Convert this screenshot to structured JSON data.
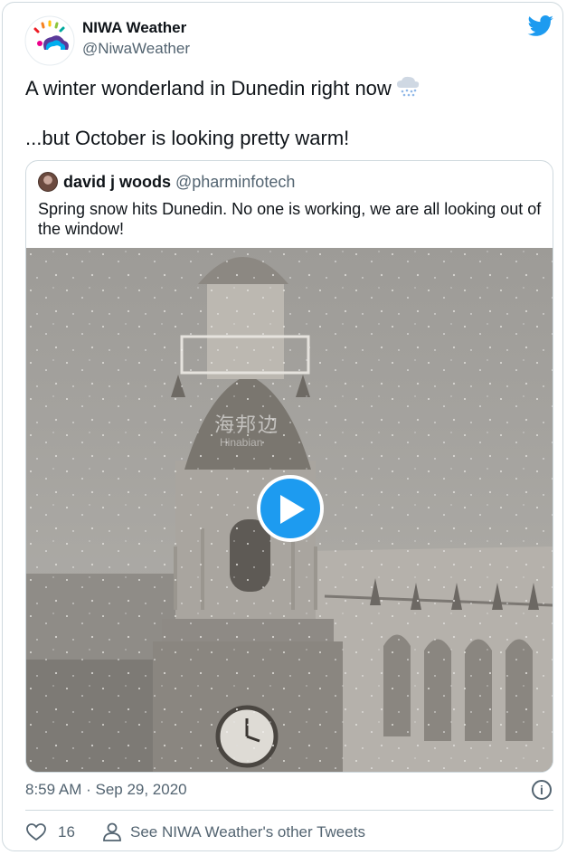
{
  "tweet": {
    "author_name": "NIWA Weather",
    "author_handle": "@NiwaWeather",
    "text_line1": "A winter wonderland in Dunedin right now",
    "text_line1_emoji": "cloud-with-snow-icon",
    "text_line2": "...but October is looking pretty warm!",
    "timestamp": "8:59 AM · Sep 29, 2020",
    "likes": "16",
    "see_other": "See NIWA Weather's other Tweets"
  },
  "quoted": {
    "author_name": "david j woods",
    "author_handle": "@pharminfotech",
    "text": "Spring snow hits Dunedin. No one is working, we are all looking out of the window!",
    "media_watermark": "海邦边",
    "media_watermark_sub": "Hinabian"
  },
  "colors": {
    "brand_blue": "#1d9bf0",
    "text_primary": "#0f1419",
    "text_secondary": "#536471",
    "border": "#cfd9de"
  }
}
